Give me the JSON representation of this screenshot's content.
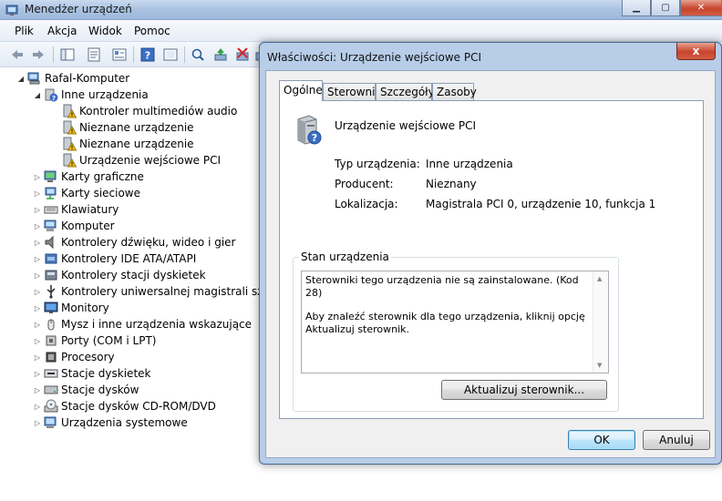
{
  "window": {
    "title": "Menedżer urządzeń"
  },
  "menu": [
    "Plik",
    "Akcja",
    "Widok",
    "Pomoc"
  ],
  "toolbar_icons": [
    "back-arrow-icon",
    "forward-arrow-icon",
    "console-tree-icon",
    "properties-icon",
    "details-icon",
    "help-icon",
    "scan-hardware-icon",
    "update-driver-icon",
    "uninstall-icon",
    "disable-icon"
  ],
  "tree": {
    "root": "Rafal-Komputer",
    "nodes": [
      {
        "label": "Inne urządzenia",
        "level": 1,
        "expanded": true,
        "icon": "other-devices-icon"
      },
      {
        "label": "Kontroler multimediów audio",
        "level": 2,
        "icon": "warning-device-icon"
      },
      {
        "label": "Nieznane urządzenie",
        "level": 2,
        "icon": "warning-device-icon"
      },
      {
        "label": "Nieznane urządzenie",
        "level": 2,
        "icon": "warning-device-icon"
      },
      {
        "label": "Urządzenie wejściowe PCI",
        "level": 2,
        "icon": "warning-device-icon"
      },
      {
        "label": "Karty graficzne",
        "level": 1,
        "icon": "display-adapter-icon"
      },
      {
        "label": "Karty sieciowe",
        "level": 1,
        "icon": "network-adapter-icon"
      },
      {
        "label": "Klawiatury",
        "level": 1,
        "icon": "keyboard-icon"
      },
      {
        "label": "Komputer",
        "level": 1,
        "icon": "computer-icon"
      },
      {
        "label": "Kontrolery dźwięku, wideo i gier",
        "level": 1,
        "icon": "speaker-icon"
      },
      {
        "label": "Kontrolery IDE ATA/ATAPI",
        "level": 1,
        "icon": "ide-controller-icon"
      },
      {
        "label": "Kontrolery stacji dyskietek",
        "level": 1,
        "icon": "floppy-controller-icon"
      },
      {
        "label": "Kontrolery uniwersalnej magistrali szereg",
        "level": 1,
        "icon": "usb-icon"
      },
      {
        "label": "Monitory",
        "level": 1,
        "icon": "monitor-icon"
      },
      {
        "label": "Mysz i inne urządzenia wskazujące",
        "level": 1,
        "icon": "mouse-icon"
      },
      {
        "label": "Porty (COM i LPT)",
        "level": 1,
        "icon": "port-icon"
      },
      {
        "label": "Procesory",
        "level": 1,
        "icon": "processor-icon"
      },
      {
        "label": "Stacje dyskietek",
        "level": 1,
        "icon": "floppy-drive-icon"
      },
      {
        "label": "Stacje dysków",
        "level": 1,
        "icon": "disk-drive-icon"
      },
      {
        "label": "Stacje dysków CD-ROM/DVD",
        "level": 1,
        "icon": "cdrom-icon"
      },
      {
        "label": "Urządzenia systemowe",
        "level": 1,
        "icon": "system-devices-icon"
      }
    ]
  },
  "dialog": {
    "title": "Właściwości: Urządzenie wejściowe PCI",
    "close_label": "x",
    "tabs": [
      "Ogólne",
      "Sterownik",
      "Szczegóły",
      "Zasoby"
    ],
    "active_tab": "Ogólne",
    "device_name": "Urządzenie wejściowe PCI",
    "props": [
      {
        "label": "Typ urządzenia:",
        "value": "Inne urządzenia"
      },
      {
        "label": "Producent:",
        "value": "Nieznany"
      },
      {
        "label": "Lokalizacja:",
        "value": "Magistrala PCI 0, urządzenie 10, funkcja 1"
      }
    ],
    "status_group_title": "Stan urządzenia",
    "status_line1": "Sterowniki tego urządzenia nie są zainstalowane. (Kod 28)",
    "status_line2": "Aby znaleźć sterownik dla tego urządzenia, kliknij opcję Aktualizuj sterownik.",
    "update_button": "Aktualizuj sterownik...",
    "ok_button": "OK",
    "cancel_button": "Anuluj"
  }
}
